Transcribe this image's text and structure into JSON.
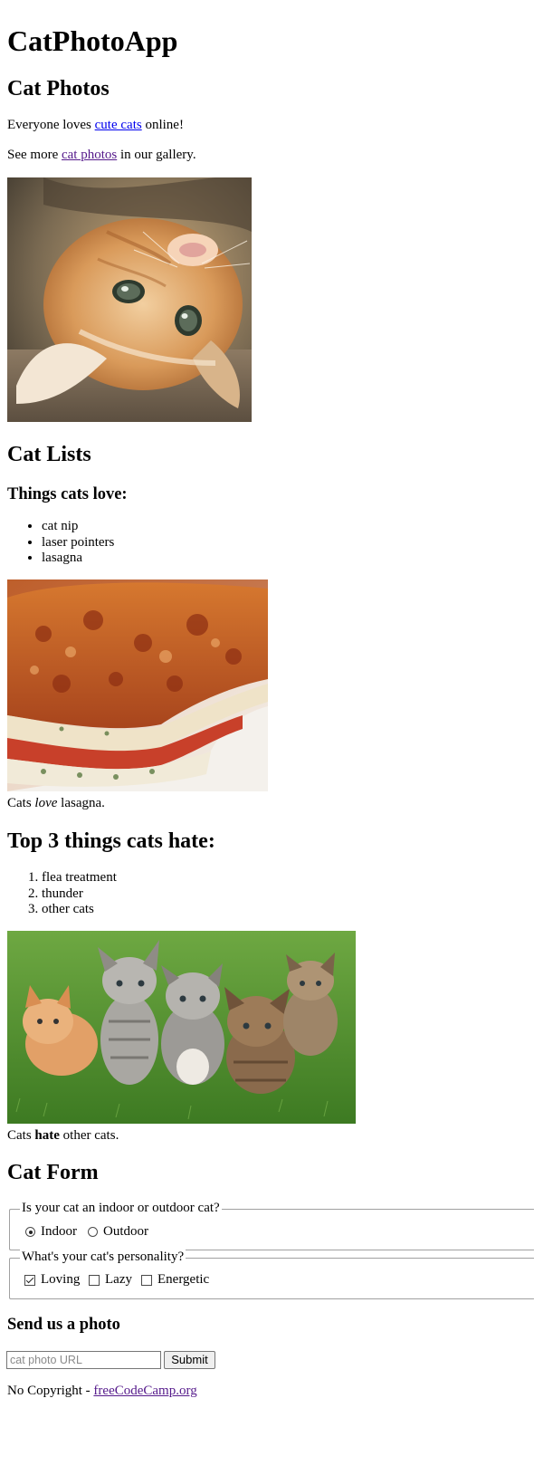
{
  "app_title": "CatPhotoApp",
  "colors": {
    "link_unvisited": "#0000ee",
    "link_visited": "#551a8b",
    "fieldset_border": "#a0a0a0"
  },
  "photos_section": {
    "heading": "Cat Photos",
    "intro": {
      "before": "Everyone loves ",
      "link_text": "cute cats",
      "after": " online!"
    },
    "gallery": {
      "before": "See more ",
      "link_text": "cat photos",
      "after": " in our gallery."
    },
    "image_name": "kitten-lying-on-back-image"
  },
  "lists_section": {
    "heading": "Cat Lists",
    "love_heading": "Things cats love:",
    "love_items": [
      "cat nip",
      "laser pointers",
      "lasagna"
    ],
    "lasagna_image": "lasagna-image",
    "lasagna_caption": {
      "before": "Cats ",
      "emphasis": "love",
      "after": " lasagna."
    },
    "hate_heading": "Top 3 things cats hate:",
    "hate_items": [
      "flea treatment",
      "thunder",
      "other cats"
    ],
    "kittens_image": "five-kittens-image",
    "kittens_caption": {
      "before": "Cats ",
      "strong": "hate",
      "after": " other cats."
    }
  },
  "form_section": {
    "heading": "Cat Form",
    "location_legend": "Is your cat an indoor or outdoor cat?",
    "location_options": [
      {
        "label": "Indoor",
        "checked": true
      },
      {
        "label": "Outdoor",
        "checked": false
      }
    ],
    "personality_legend": "What's your cat's personality?",
    "personality_options": [
      {
        "label": "Loving",
        "checked": true
      },
      {
        "label": "Lazy",
        "checked": false
      },
      {
        "label": "Energetic",
        "checked": false
      }
    ],
    "send_heading": "Send us a photo",
    "url_input": {
      "value": "",
      "placeholder": "cat photo URL"
    },
    "submit_label": "Submit"
  },
  "footer": {
    "prefix": "No Copyright - ",
    "link_text": "freeCodeCamp.org"
  }
}
